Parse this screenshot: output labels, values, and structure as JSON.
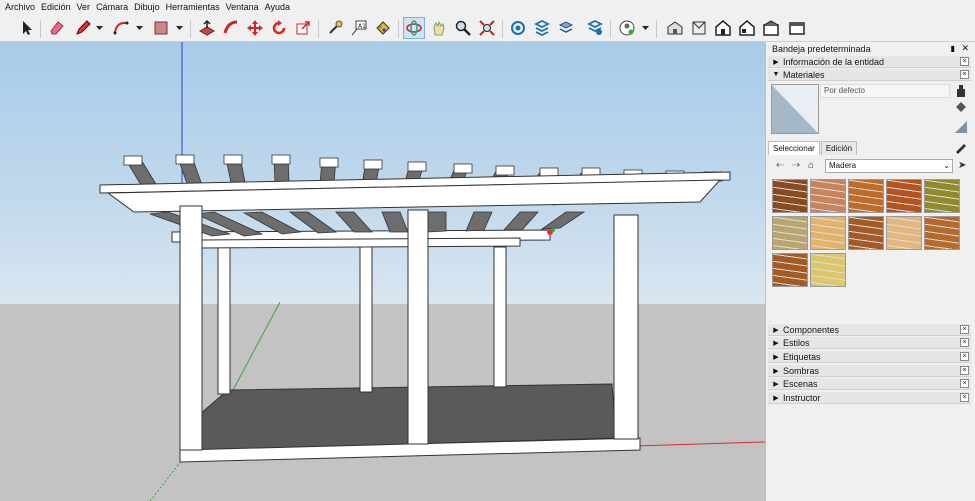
{
  "menu": [
    "Archivo",
    "Edición",
    "Ver",
    "Cámara",
    "Dibujo",
    "Herramientas",
    "Ventana",
    "Ayuda"
  ],
  "toolbar": {
    "tools": [
      {
        "name": "select-tool-icon"
      },
      {
        "name": "eraser-tool-icon"
      },
      {
        "name": "pencil-line-tool-icon"
      },
      {
        "name": "arc-tool-icon"
      },
      {
        "name": "rectangle-tool-icon"
      },
      {
        "name": "push-pull-tool-icon"
      },
      {
        "name": "follow-me-tool-icon"
      },
      {
        "name": "move-tool-icon"
      },
      {
        "name": "rotate-tool-icon"
      },
      {
        "name": "scale-tool-icon"
      },
      {
        "name": "tape-measure-tool-icon"
      },
      {
        "name": "text-tool-icon"
      },
      {
        "name": "paint-bucket-tool-icon"
      },
      {
        "name": "orbit-tool-icon"
      },
      {
        "name": "pan-tool-icon"
      },
      {
        "name": "zoom-tool-icon"
      },
      {
        "name": "zoom-extents-tool-icon"
      },
      {
        "name": "3d-warehouse-icon"
      },
      {
        "name": "extension-warehouse-icon"
      },
      {
        "name": "layout-icon"
      },
      {
        "name": "extension-manager-icon"
      },
      {
        "name": "account-icon"
      },
      {
        "name": "iso-view-icon"
      },
      {
        "name": "top-view-icon"
      },
      {
        "name": "front-view-icon"
      },
      {
        "name": "right-view-icon"
      },
      {
        "name": "back-view-icon"
      }
    ]
  },
  "tray": {
    "title": "Bandeja predeterminada",
    "entity_info": "Información de la entidad",
    "materials": {
      "label": "Materiales",
      "current_name": "Por defecto",
      "tabs": [
        "Seleccionar",
        "Edición"
      ],
      "collection": "Madera",
      "swatch_colors": [
        "#8a4a1f",
        "#c9825a",
        "#c36a25",
        "#b6541e",
        "#8f8b2a",
        "#b9a66f",
        "#e2b46a",
        "#a55a26",
        "#e2b87e",
        "#b56a2c",
        "#a45a22",
        "#dcc86a"
      ]
    },
    "collapsed_panels": [
      "Componentes",
      "Estilos",
      "Etiquetas",
      "Sombras",
      "Escenas",
      "Instructor"
    ]
  },
  "colors": {
    "model_face": "#ffffff",
    "edge": "#333333",
    "floor": "#5a5a5a",
    "beam_shade": "#707070"
  }
}
